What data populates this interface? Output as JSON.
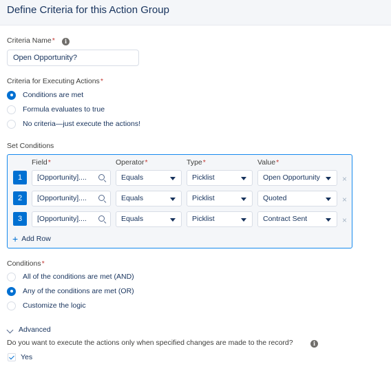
{
  "header": {
    "title": "Define Criteria for this Action Group"
  },
  "criteria_name": {
    "label": "Criteria Name",
    "required": "*",
    "value": "Open Opportunity?"
  },
  "executing": {
    "label": "Criteria for Executing Actions",
    "required": "*",
    "options": [
      {
        "label": "Conditions are met",
        "checked": true
      },
      {
        "label": "Formula evaluates to true",
        "checked": false
      },
      {
        "label": "No criteria—just execute the actions!",
        "checked": false
      }
    ]
  },
  "set_conditions": {
    "label": "Set Conditions",
    "columns": {
      "field": "Field",
      "operator": "Operator",
      "type": "Type",
      "value": "Value",
      "required": "*"
    },
    "rows": [
      {
        "num": "1",
        "field": "[Opportunity]....",
        "operator": "Equals",
        "type": "Picklist",
        "value": "Open Opportunity"
      },
      {
        "num": "2",
        "field": "[Opportunity]....",
        "operator": "Equals",
        "type": "Picklist",
        "value": "Quoted"
      },
      {
        "num": "3",
        "field": "[Opportunity]....",
        "operator": "Equals",
        "type": "Picklist",
        "value": "Contract Sent"
      }
    ],
    "add_row": "Add Row",
    "remove": "×"
  },
  "conditions": {
    "label": "Conditions",
    "required": "*",
    "options": [
      {
        "label": "All of the conditions are met (AND)",
        "checked": false
      },
      {
        "label": "Any of the conditions are met (OR)",
        "checked": true
      },
      {
        "label": "Customize the logic",
        "checked": false
      }
    ]
  },
  "advanced": {
    "label": "Advanced",
    "question": "Do you want to execute the actions only when specified changes are made to the record?",
    "checkbox_label": "Yes",
    "checked": true
  },
  "colors": {
    "accent": "#0070d2",
    "text": "#16325c",
    "required": "#c23934",
    "box_border": "#1589ee"
  },
  "icons": [
    "info-icon",
    "search-icon",
    "chevron-down-icon",
    "close-icon",
    "plus-icon",
    "checkbox-icon"
  ]
}
